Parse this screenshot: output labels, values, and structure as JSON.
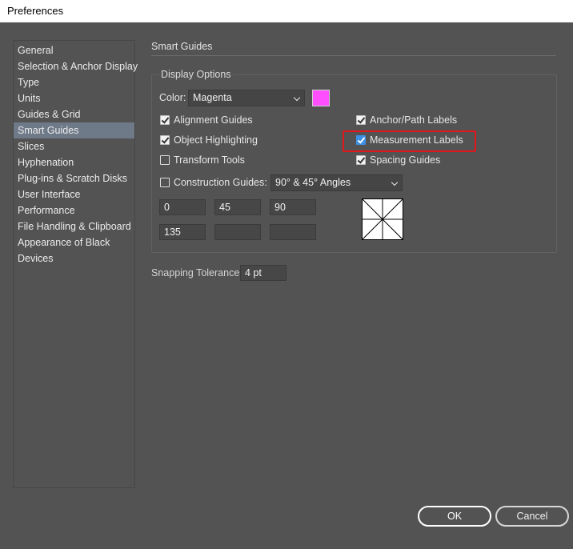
{
  "window": {
    "title": "Preferences"
  },
  "sidebar": {
    "items": [
      {
        "label": "General"
      },
      {
        "label": "Selection & Anchor Display"
      },
      {
        "label": "Type"
      },
      {
        "label": "Units"
      },
      {
        "label": "Guides & Grid"
      },
      {
        "label": "Smart Guides",
        "selected": true
      },
      {
        "label": "Slices"
      },
      {
        "label": "Hyphenation"
      },
      {
        "label": "Plug-ins & Scratch Disks"
      },
      {
        "label": "User Interface"
      },
      {
        "label": "Performance"
      },
      {
        "label": "File Handling & Clipboard"
      },
      {
        "label": "Appearance of Black"
      },
      {
        "label": "Devices"
      }
    ]
  },
  "panel": {
    "title": "Smart Guides",
    "display_options": {
      "title": "Display Options",
      "color_label": "Color:",
      "color_value": "Magenta",
      "swatch_color": "#ff4fff",
      "checks": {
        "alignment_guides": {
          "label": "Alignment Guides",
          "checked": true
        },
        "object_highlighting": {
          "label": "Object Highlighting",
          "checked": true
        },
        "transform_tools": {
          "label": "Transform Tools",
          "checked": false
        },
        "anchor_path_labels": {
          "label": "Anchor/Path Labels",
          "checked": true
        },
        "measurement_labels": {
          "label": "Measurement Labels",
          "checked": true
        },
        "spacing_guides": {
          "label": "Spacing Guides",
          "checked": true
        },
        "construction_guides": {
          "label": "Construction Guides:",
          "checked": false
        }
      },
      "construction_angles_value": "90° & 45° Angles",
      "angles": [
        "0",
        "45",
        "90",
        "135",
        "",
        ""
      ]
    },
    "snapping": {
      "label": "Snapping Tolerance:",
      "value": "4 pt"
    }
  },
  "buttons": {
    "ok": "OK",
    "cancel": "Cancel"
  },
  "colors": {
    "background": "#535353",
    "selected_row": "#6f7a89",
    "highlight": "#e0181c",
    "checkbox_active": "#3c8fe6"
  }
}
